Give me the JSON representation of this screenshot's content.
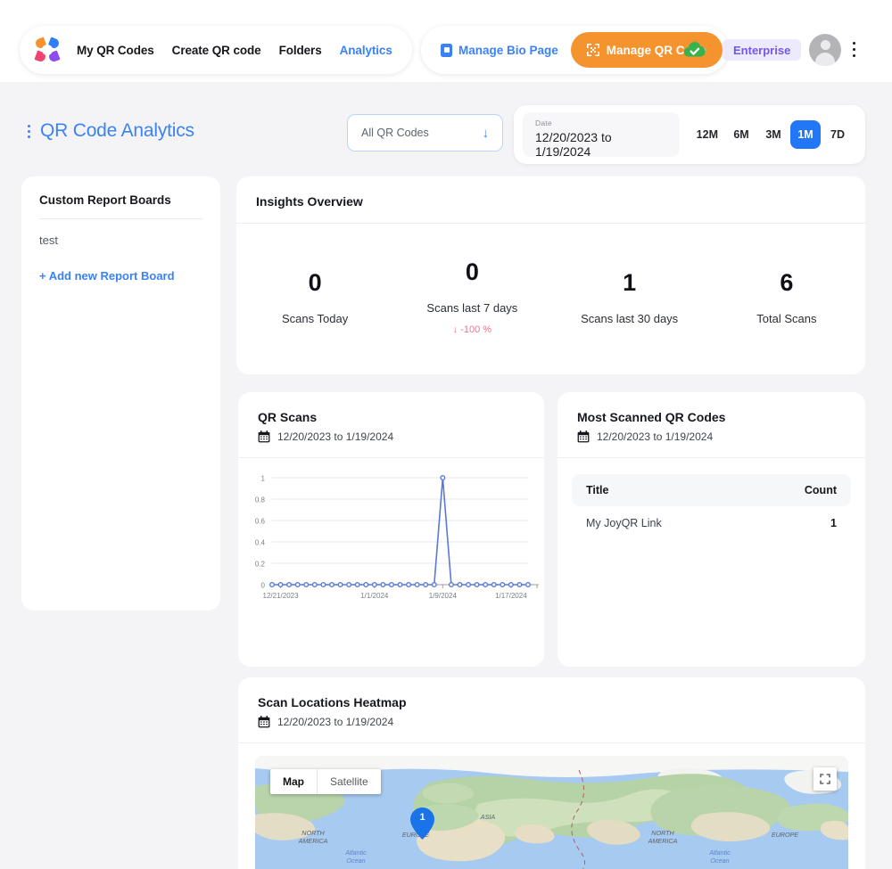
{
  "nav": {
    "logo_icon": "joyqr-logo-icon",
    "links": [
      {
        "label": "My QR Codes",
        "active": false
      },
      {
        "label": "Create QR code",
        "active": false
      },
      {
        "label": "Folders",
        "active": false
      },
      {
        "label": "Analytics",
        "active": true
      }
    ],
    "manage_bio_page": "Manage Bio Page",
    "manage_bio_icon": "bio-page-icon",
    "manage_qr_code": "Manage QR Code",
    "manage_qr_icon": "qr-code-icon",
    "cloud_status_icon": "cloud-check-icon",
    "plan_badge": "Enterprise",
    "avatar_icon": "user-avatar-icon",
    "more_icon": "kebab-menu-icon",
    "accent_blue": "#3b82f6",
    "accent_orange": "#f5932f",
    "badge_purple": "#7457e8"
  },
  "header": {
    "drag_icon": "drag-handle-icon",
    "title": "QR Code Analytics",
    "qr_filter": {
      "value": "All QR Codes",
      "caret_icon": "arrow-down-icon"
    },
    "date": {
      "label": "Date",
      "value": "12/20/2023 to 1/19/2024"
    },
    "ranges": [
      {
        "label": "12M",
        "active": false
      },
      {
        "label": "6M",
        "active": false
      },
      {
        "label": "3M",
        "active": false
      },
      {
        "label": "1M",
        "active": true
      },
      {
        "label": "7D",
        "active": false
      }
    ]
  },
  "sidebar": {
    "title": "Custom Report Boards",
    "items": [
      {
        "label": "test"
      }
    ],
    "add_label": "+ Add new Report Board"
  },
  "insights": {
    "title": "Insights Overview",
    "stats": [
      {
        "value": "0",
        "caption": "Scans Today",
        "delta": ""
      },
      {
        "value": "0",
        "caption": "Scans last 7 days",
        "delta": "↓ -100 %"
      },
      {
        "value": "1",
        "caption": "Scans last 30 days",
        "delta": ""
      },
      {
        "value": "6",
        "caption": "Total Scans",
        "delta": ""
      }
    ],
    "delta_color": "#f2728c"
  },
  "qr_scans": {
    "title": "QR Scans",
    "calendar_icon": "calendar-icon",
    "date_range": "12/20/2023 to 1/19/2024"
  },
  "most_scanned": {
    "title": "Most Scanned QR Codes",
    "calendar_icon": "calendar-icon",
    "date_range": "12/20/2023 to 1/19/2024",
    "columns": [
      "Title",
      "Count"
    ],
    "rows": [
      {
        "title": "My JoyQR Link",
        "count": "1"
      }
    ]
  },
  "heatmap": {
    "title": "Scan Locations Heatmap",
    "calendar_icon": "calendar-icon",
    "date_range": "12/20/2023 to 1/19/2024",
    "map_toggle": [
      {
        "label": "Map",
        "active": true
      },
      {
        "label": "Satellite",
        "active": false
      }
    ],
    "fullscreen_icon": "fullscreen-icon",
    "marker": {
      "count": "1",
      "region": "EUROPE"
    },
    "labels": [
      "NORTH\nAMERICA",
      "Atlantic\nOcean",
      "EUROPE",
      "ASIA",
      "NORTH\nAMERICA",
      "Atlantic\nOcean",
      "EUROPE"
    ]
  },
  "chart_data": {
    "type": "line",
    "title": "QR Scans",
    "xlabel": "",
    "ylabel": "",
    "ylim": [
      0,
      1
    ],
    "yticks": [
      "0",
      "0.2",
      "0.4",
      "0.6",
      "0.8",
      "1"
    ],
    "xticks": [
      "12/21/2023",
      "1/1/2024",
      "1/9/2024",
      "1/17/2024"
    ],
    "grid": true,
    "legend": "none",
    "line_color": "#5b79d6",
    "x": [
      "12/20/2023",
      "12/21/2023",
      "12/22/2023",
      "12/23/2023",
      "12/24/2023",
      "12/25/2023",
      "12/26/2023",
      "12/27/2023",
      "12/28/2023",
      "12/29/2023",
      "12/30/2023",
      "12/31/2023",
      "1/1/2024",
      "1/2/2024",
      "1/3/2024",
      "1/4/2024",
      "1/5/2024",
      "1/6/2024",
      "1/7/2024",
      "1/8/2024",
      "1/9/2024",
      "1/10/2024",
      "1/11/2024",
      "1/12/2024",
      "1/13/2024",
      "1/14/2024",
      "1/15/2024",
      "1/16/2024",
      "1/17/2024",
      "1/18/2024",
      "1/19/2024"
    ],
    "values": [
      0,
      0,
      0,
      0,
      0,
      0,
      0,
      0,
      0,
      0,
      0,
      0,
      0,
      0,
      0,
      0,
      0,
      0,
      0,
      0,
      1,
      0,
      0,
      0,
      0,
      0,
      0,
      0,
      0,
      0,
      0
    ]
  }
}
